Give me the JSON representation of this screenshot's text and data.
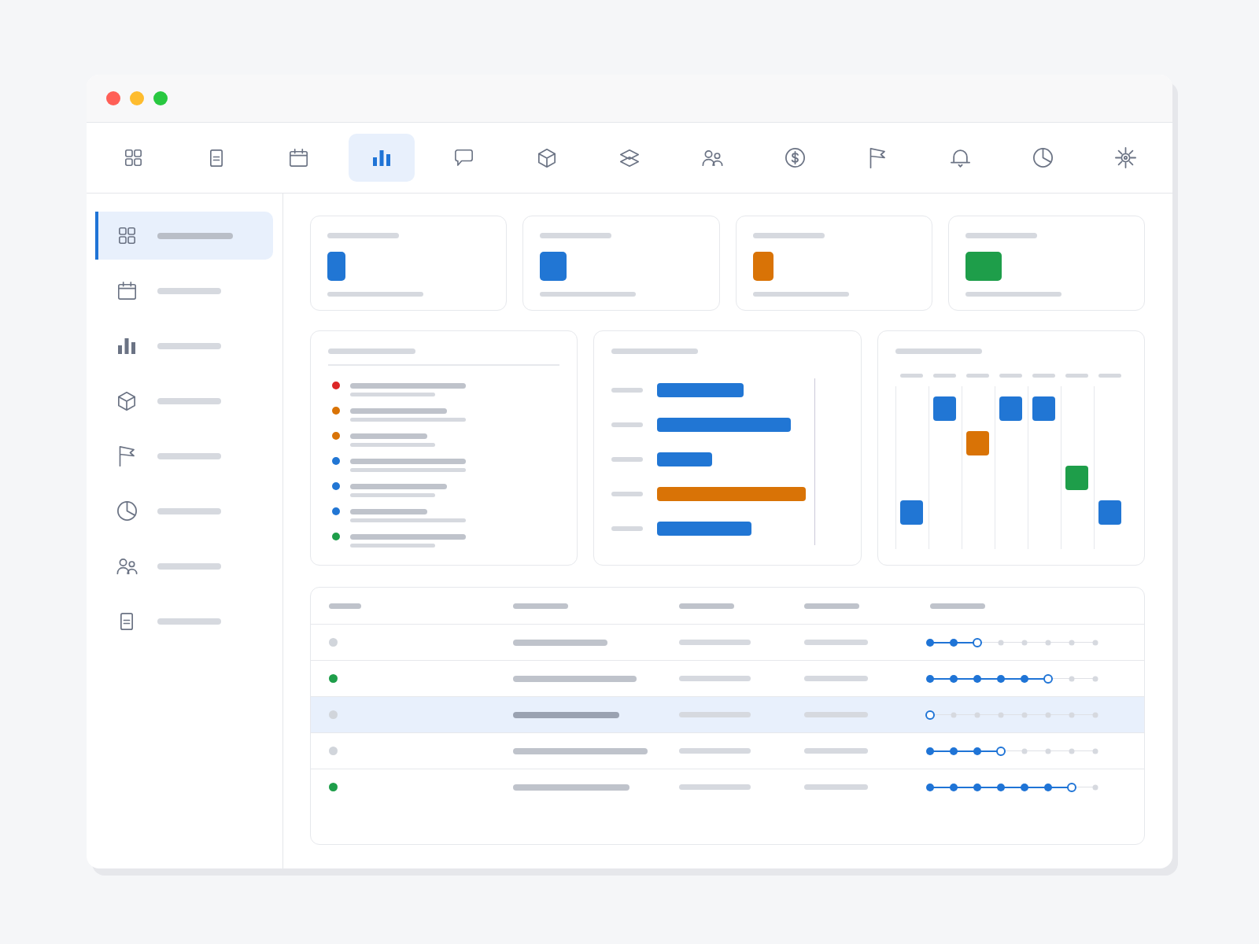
{
  "toolbar": {
    "items": [
      {
        "selected": false
      },
      {
        "selected": false
      },
      {
        "selected": false
      },
      {
        "selected": true
      },
      {
        "selected": false
      },
      {
        "selected": false
      },
      {
        "selected": false
      },
      {
        "selected": false
      },
      {
        "selected": false
      },
      {
        "selected": false
      },
      {
        "selected": false
      },
      {
        "selected": false
      },
      {
        "selected": false
      }
    ]
  },
  "sidebar": {
    "items": [
      {
        "selected": true
      },
      {
        "selected": false
      },
      {
        "selected": false
      },
      {
        "selected": false
      },
      {
        "selected": false
      },
      {
        "selected": false
      },
      {
        "selected": false
      },
      {
        "selected": false
      }
    ]
  },
  "stat_cards": [
    {
      "color": "#2176d4"
    },
    {
      "color": "#2176d4"
    },
    {
      "color": "#d97306"
    },
    {
      "color": "#1e9e4a"
    }
  ],
  "list_card": {
    "items": [
      {
        "color": "#dc2626"
      },
      {
        "color": "#d97306"
      },
      {
        "color": "#d97306"
      },
      {
        "color": "#2176d4"
      },
      {
        "color": "#2176d4"
      },
      {
        "color": "#2176d4"
      },
      {
        "color": "#1e9e4a"
      }
    ]
  },
  "bar_card": {
    "bars": [
      {
        "color": "#2176d4"
      },
      {
        "color": "#2176d4"
      },
      {
        "color": "#2176d4"
      },
      {
        "color": "#d97306"
      },
      {
        "color": "#2176d4"
      }
    ]
  },
  "schedule_card": {
    "days": [
      {
        "color": "#2176d4"
      },
      {
        "color": "#2176d4"
      },
      {
        "color": "#d97306"
      },
      {
        "color": "#2176d4"
      },
      {
        "color": "#2176d4"
      },
      {
        "color": "#1e9e4a"
      },
      {
        "color": "#2176d4"
      }
    ]
  },
  "table": {
    "rows": [
      {
        "color": "#d1d5db",
        "selected": false,
        "level": 0.29
      },
      {
        "color": "#1e9e4a",
        "selected": false,
        "level": 0.71
      },
      {
        "color": "#d1d5db",
        "selected": true,
        "level": 0
      },
      {
        "color": "#d1d5db",
        "selected": false,
        "level": 0.43
      },
      {
        "color": "#1e9e4a",
        "selected": false,
        "level": 0.86
      }
    ]
  }
}
